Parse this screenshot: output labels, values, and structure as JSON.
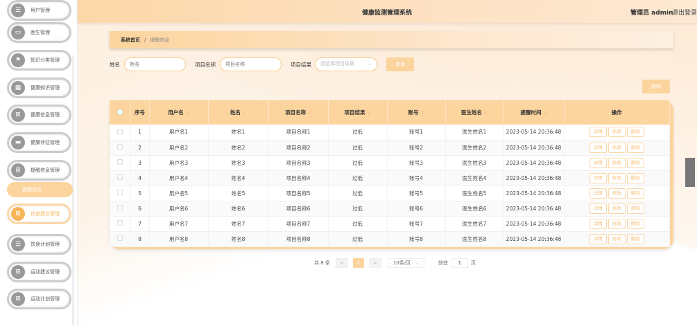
{
  "header": {
    "title": "健康监测管理系统",
    "user": "管理员 admin",
    "logout": "退出登录"
  },
  "sidebar": {
    "items": [
      {
        "label": "用户管理",
        "icon": "list-icon"
      },
      {
        "label": "医生管理",
        "icon": "monitor-icon"
      },
      {
        "label": "知识分类管理",
        "icon": "flag-icon"
      },
      {
        "label": "健康知识管理",
        "icon": "table-icon"
      },
      {
        "label": "健康信息管理",
        "icon": "grid-icon"
      },
      {
        "label": "健康评估管理",
        "icon": "chat-icon"
      },
      {
        "label": "提醒信息管理",
        "icon": "grid-icon"
      },
      {
        "label": "饮食建议管理",
        "icon": "grid-icon"
      },
      {
        "label": "饮食计划管理",
        "icon": "list-icon"
      },
      {
        "label": "运动建议管理",
        "icon": "grid-icon"
      },
      {
        "label": "运动计划管理",
        "icon": "grid-icon"
      }
    ],
    "submenu": "提醒信息"
  },
  "breadcrumb": {
    "home": "系统首页",
    "sep": "/",
    "current": "提醒信息"
  },
  "filters": {
    "name_label": "姓名",
    "name_placeholder": "姓名",
    "project_label": "项目名称",
    "project_placeholder": "项目名称",
    "result_label": "项目结果",
    "result_placeholder": "请选择项目结果",
    "search": "查询"
  },
  "delete_label": "删除",
  "table": {
    "headers": [
      "序号",
      "用户名",
      "姓名",
      "项目名称",
      "项目结果",
      "账号",
      "医生姓名",
      "提醒时间",
      "操作"
    ],
    "rows": [
      [
        "1",
        "用户名1",
        "姓名1",
        "项目名称1",
        "过低",
        "账号1",
        "医生姓名1",
        "2023-05-14 20:36:48"
      ],
      [
        "2",
        "用户名2",
        "姓名2",
        "项目名称2",
        "过低",
        "账号2",
        "医生姓名2",
        "2023-05-14 20:36:48"
      ],
      [
        "3",
        "用户名3",
        "姓名3",
        "项目名称3",
        "过低",
        "账号3",
        "医生姓名3",
        "2023-05-14 20:36:48"
      ],
      [
        "4",
        "用户名4",
        "姓名4",
        "项目名称4",
        "过低",
        "账号4",
        "医生姓名4",
        "2023-05-14 20:36:48"
      ],
      [
        "5",
        "用户名5",
        "姓名5",
        "项目名称5",
        "过低",
        "账号5",
        "医生姓名5",
        "2023-05-14 20:36:48"
      ],
      [
        "6",
        "用户名6",
        "姓名6",
        "项目名称6",
        "过低",
        "账号6",
        "医生姓名6",
        "2023-05-14 20:36:48"
      ],
      [
        "7",
        "用户名7",
        "姓名7",
        "项目名称7",
        "过低",
        "账号7",
        "医生姓名7",
        "2023-05-14 20:36:48"
      ],
      [
        "8",
        "用户名8",
        "姓名8",
        "项目名称8",
        "过低",
        "账号8",
        "医生姓名8",
        "2023-05-14 20:36:48"
      ]
    ],
    "actions": [
      "详情",
      "修改",
      "删除"
    ]
  },
  "pagination": {
    "total": "共 8 条",
    "prev": "<",
    "page": "1",
    "next": ">",
    "size": "10条/页",
    "goto": "前往",
    "goto_value": "1",
    "unit": "页"
  }
}
